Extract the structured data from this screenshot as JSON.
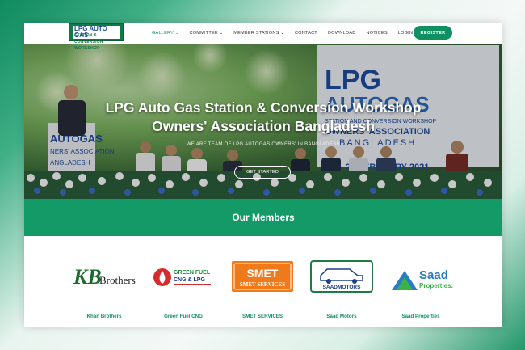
{
  "header": {
    "logo_text_main": "LPG AUTO GAS",
    "logo_text_sub": "STATION & CONVERSION WORKSHOP",
    "nav": [
      {
        "label": "GALLERY",
        "dropdown": true,
        "active": true
      },
      {
        "label": "COMMITTEE",
        "dropdown": true,
        "active": false
      },
      {
        "label": "MEMBER STATIONS",
        "dropdown": true,
        "active": false
      },
      {
        "label": "CONTACT",
        "dropdown": false,
        "active": false
      },
      {
        "label": "DOWNLOAD",
        "dropdown": false,
        "active": false
      },
      {
        "label": "NOTICES",
        "dropdown": false,
        "active": false
      },
      {
        "label": "LOGIN",
        "dropdown": false,
        "active": false
      }
    ],
    "register_label": "REGISTER"
  },
  "hero": {
    "title_line1": "LPG Auto Gas Station & Conversion Workshop",
    "title_line2": "Owners' Association Bangladesh",
    "subtitle": "WE ARE TEAM OF LPG AUTOGAS OWNERS' IN BANGLADESH",
    "cta_label": "GET STARTED",
    "banner_text": {
      "lpg": "LPG",
      "autogas": "AUTOGAS",
      "station": "STATION AND CONVERSION WORKSHOP",
      "association": "OWNERS' ASSOCIATION",
      "country": "BANGLADESH",
      "date": "27 FEBRUARY 2021"
    }
  },
  "members": {
    "title": "Our Members",
    "items": [
      {
        "name": "Khan Brothers",
        "logo_text": "Brothers",
        "logo_mark": "KB"
      },
      {
        "name": "Green Fuel CNG",
        "logo_text": "GREEN FUEL CNG & LPG"
      },
      {
        "name": "SMET SERVICES",
        "logo_text": "SMET",
        "logo_sub": "SMET SERVICES"
      },
      {
        "name": "Saad Motors",
        "logo_text": "SAADMOTORS"
      },
      {
        "name": "Saad Properties",
        "logo_text": "Saad",
        "logo_sub": "Properties."
      }
    ]
  },
  "colors": {
    "brand_green": "#139a66",
    "nav_active": "#0f9060",
    "text": "#333333"
  }
}
